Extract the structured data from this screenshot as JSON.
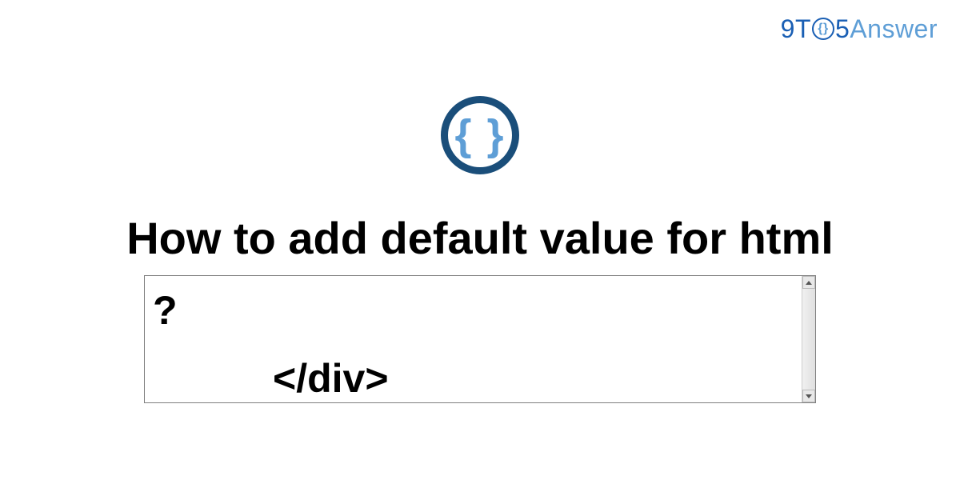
{
  "logo": {
    "part_9t": "9T",
    "part_o_inner": "{}",
    "part_5": "5",
    "part_answer": "Answer"
  },
  "icon": {
    "braces": "{ }"
  },
  "title": "How to add default value for html",
  "textarea": {
    "line1": "?",
    "line2": "</div>"
  }
}
